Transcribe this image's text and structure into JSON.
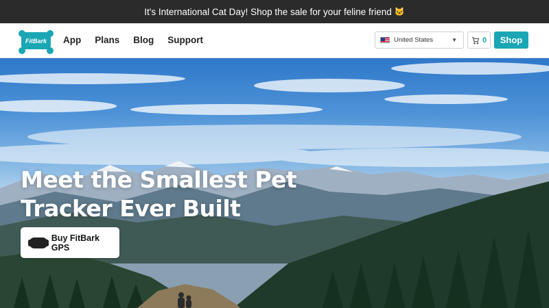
{
  "announcement": {
    "text": "It's International Cat Day! Shop the sale for your feline friend",
    "emoji": "🐱"
  },
  "header": {
    "logo_text": "FitBark",
    "nav": [
      {
        "label": "App"
      },
      {
        "label": "Plans"
      },
      {
        "label": "Blog"
      },
      {
        "label": "Support"
      }
    ],
    "country_selector": {
      "value": "United States",
      "flag_icon": "us-flag-icon"
    },
    "cart": {
      "count": "0",
      "icon": "cart-icon"
    },
    "shop_label": "Shop"
  },
  "hero": {
    "title": "Meet the Smallest Pet Tracker Ever Built",
    "cta_label": "Buy FitBark GPS",
    "cta_icon": "fitbark-device-icon"
  },
  "colors": {
    "accent": "#1aa6b4",
    "announce_bg": "#2b2b2b"
  }
}
